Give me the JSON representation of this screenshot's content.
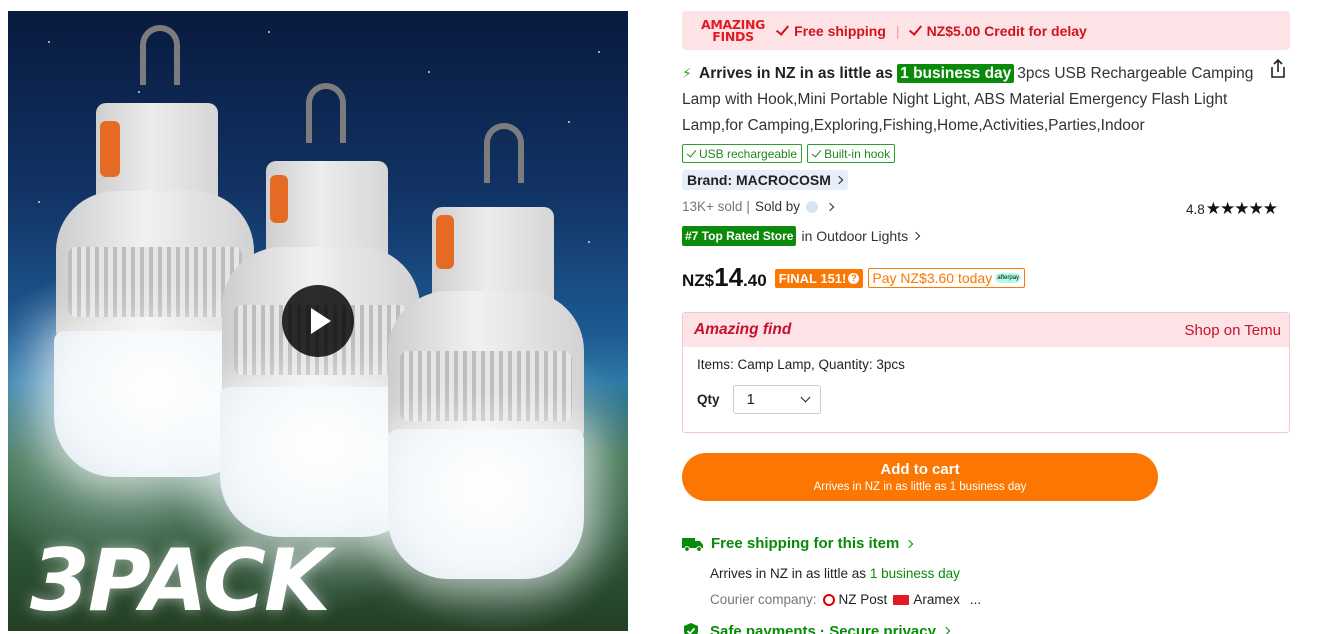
{
  "gallery": {
    "overlay_text": "3PACK",
    "play_icon": "play-icon"
  },
  "banner": {
    "logo_line1": "AMAZING",
    "logo_line2": "FINDS",
    "free_shipping": "Free shipping",
    "separator": "|",
    "credit": "NZ$5.00 Credit for delay",
    "color": "#d1131f"
  },
  "product": {
    "bolt_icon": "lightning-icon",
    "arrives_prefix": "Arrives in NZ in as little as",
    "arrives_highlight": "1 business day",
    "title": "3pcs USB Rechargeable Camping Lamp with Hook,Mini Portable Night Light, ABS Material Emergency Flash Light Lamp,for Camping,Exploring,Fishing,Home,Activities,Parties,Indoor",
    "share_icon": "share-icon",
    "tags": [
      "USB rechargeable",
      "Built-in hook"
    ],
    "brand": "Brand: MACROCOSM",
    "sold": "13K+ sold",
    "sold_separator": "|",
    "sold_by": "Sold by",
    "rating": "4.8",
    "stars": "★★★★★",
    "rank_badge": "#7 Top Rated Store",
    "rank_category": "in Outdoor Lights",
    "accent_green": "#0a8a0a"
  },
  "price": {
    "currency": "NZ$",
    "integer": "14",
    "decimal": ".40",
    "final_badge": "FINAL 151!",
    "final_badge_icon": "?",
    "pay_today": "Pay NZ$3.60 today",
    "afterpay_icon": "afterpay-logo",
    "afterpay_text": "afterpay",
    "accent_orange": "#fb7701"
  },
  "amazing_box": {
    "title": "Amazing find",
    "shop_link": "Shop on Temu",
    "items_text": "Items: Camp Lamp, Quantity: 3pcs",
    "qty_label": "Qty",
    "qty_value": "1"
  },
  "cart": {
    "label": "Add to cart",
    "sublabel": "Arrives in NZ in as little as 1 business day"
  },
  "shipping": {
    "truck_icon": "truck-icon",
    "free_shipping_item": "Free shipping for this item",
    "arrives_prefix": "Arrives in NZ in as little as",
    "arrives_highlight": "1 business day",
    "courier_label": "Courier company:",
    "courier1": "NZ Post",
    "courier2": "Aramex",
    "courier_more": "...",
    "safe_payments": "Safe payments · Secure privacy",
    "shield_icon": "shield-check-icon"
  }
}
